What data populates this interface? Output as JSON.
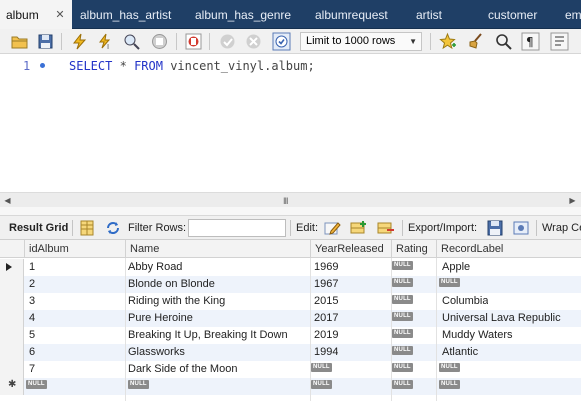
{
  "tabs": [
    {
      "label": "album",
      "active": true
    },
    {
      "label": "album_has_artist"
    },
    {
      "label": "album_has_genre"
    },
    {
      "label": "albumrequest"
    },
    {
      "label": "artist"
    },
    {
      "label": "customer"
    },
    {
      "label": "em"
    }
  ],
  "tab_close_glyph": "✕",
  "toolbar": {
    "limit_label": "Limit to 1000 rows",
    "icons": [
      "open-folder-icon",
      "save-icon",
      "execute-lightning-icon",
      "execute-current-icon",
      "explain-icon",
      "stop-icon",
      "toggle-continue-on-error-icon",
      "commit-icon",
      "rollback-icon",
      "autocommit-icon",
      "beautify-icon",
      "broom-icon",
      "find-icon",
      "invisible-chars-icon",
      "wrap-icon"
    ]
  },
  "editor": {
    "line_number": "1",
    "keyword_select": "SELECT",
    "star": "*",
    "keyword_from": "FROM",
    "table_ref": "vincent_vinyl.album;"
  },
  "hscroll": {
    "grip": "III"
  },
  "result_toolbar": {
    "result_grid": "Result Grid",
    "filter_rows": "Filter Rows:",
    "edit": "Edit:",
    "export_import": "Export/Import:",
    "wrap": "Wrap Ce"
  },
  "grid": {
    "columns": [
      "idAlbum",
      "Name",
      "YearReleased",
      "Rating",
      "RecordLabel"
    ],
    "null_text": "NULL",
    "rows": [
      {
        "idAlbum": "1",
        "Name": "Abby Road",
        "YearReleased": "1969",
        "Rating": null,
        "RecordLabel": "Apple"
      },
      {
        "idAlbum": "2",
        "Name": "Blonde on Blonde",
        "YearReleased": "1967",
        "Rating": null,
        "RecordLabel": null
      },
      {
        "idAlbum": "3",
        "Name": "Riding with the King",
        "YearReleased": "2015",
        "Rating": null,
        "RecordLabel": "Columbia"
      },
      {
        "idAlbum": "4",
        "Name": "Pure Heroine",
        "YearReleased": "2017",
        "Rating": null,
        "RecordLabel": "Universal Lava Republic"
      },
      {
        "idAlbum": "5",
        "Name": "Breaking It Up, Breaking It Down",
        "YearReleased": "2019",
        "Rating": null,
        "RecordLabel": "Muddy Waters"
      },
      {
        "idAlbum": "6",
        "Name": "Glassworks",
        "YearReleased": "1994",
        "Rating": null,
        "RecordLabel": "Atlantic"
      },
      {
        "idAlbum": "7",
        "Name": "Dark Side of the Moon",
        "YearReleased": null,
        "Rating": null,
        "RecordLabel": null
      }
    ],
    "new_row": {
      "idAlbum": null,
      "Name": null,
      "YearReleased": null,
      "Rating": null,
      "RecordLabel": null
    },
    "new_row_marker": "✱"
  },
  "colors": {
    "tabbar": "#1f3f66",
    "keyword": "#2233c8",
    "null_badge": "#8a8a8a",
    "alt_row": "#eef3fb"
  }
}
